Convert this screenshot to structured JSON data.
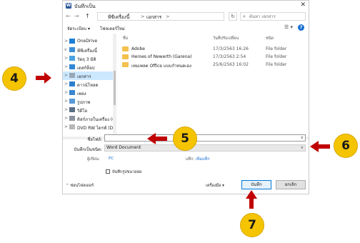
{
  "window": {
    "title": "บันทึกเป็น",
    "app_icon_letter": "W",
    "close_glyph": "✕"
  },
  "address": {
    "back_glyph": "←",
    "forward_glyph": "→",
    "up_glyph": "↑",
    "breadcrumbs": [
      "พีซีเครื่องนี้",
      "เอกสาร"
    ],
    "separator": ">",
    "refresh_glyph": "↻",
    "search_placeholder": "ค้นหา เอกสาร"
  },
  "toolbar": {
    "organize_label": "จัดระเบียบ ▾",
    "new_folder_label": "โฟลเดอร์ใหม่",
    "view_glyph": "☰ ▾",
    "help_glyph": "?"
  },
  "sidebar": {
    "items": [
      {
        "label": "OneDrive",
        "icon": "cloud-icon",
        "chevron": ">",
        "color": "#1a7fd4"
      },
      {
        "label": "พีซีเครื่องนี้",
        "icon": "computer-icon",
        "chevron": "v",
        "color": "#3b8fd8"
      },
      {
        "label": "วัตถุ 3 มิติ",
        "icon": "cube-icon",
        "chevron": ">",
        "color": "#4aa3e0"
      },
      {
        "label": "เดสก์ท็อป",
        "icon": "desktop-icon",
        "chevron": ">",
        "color": "#2f87d6"
      },
      {
        "label": "เอกสาร",
        "icon": "document-icon",
        "chevron": ">",
        "color": "#9aa7b5",
        "selected": true
      },
      {
        "label": "ดาวน์โหลด",
        "icon": "download-icon",
        "chevron": ">",
        "color": "#2d7fd0"
      },
      {
        "label": "เพลง",
        "icon": "music-icon",
        "chevron": ">",
        "color": "#3a86cf"
      },
      {
        "label": "รูปภาพ",
        "icon": "picture-icon",
        "chevron": ">",
        "color": "#5a9ad8"
      },
      {
        "label": "วิดีโอ",
        "icon": "video-icon",
        "chevron": ">",
        "color": "#5a6f86"
      },
      {
        "label": "ดิสก์ภายในเครื่อง (C",
        "icon": "drive-icon",
        "chevron": ">",
        "color": "#8a949e"
      },
      {
        "label": "DVD RW ไดรฟ์ (D",
        "icon": "dvd-icon",
        "chevron": ">",
        "color": "#b7b7b7"
      }
    ]
  },
  "files": {
    "columns": [
      "ชื่อ",
      "วันที่ปรับเปลี่ยน",
      "ชนิด"
    ],
    "rows": [
      {
        "name": "Adobe",
        "date": "17/3/2563 16:26",
        "type": "File folder"
      },
      {
        "name": "Heroes of Newerth (Garena)",
        "date": "17/3/2563 2:54",
        "type": "File folder"
      },
      {
        "name": "เทมเพลต Office แบบกำหนดเอง",
        "date": "25/6/2563 16:02",
        "type": "File folder"
      }
    ]
  },
  "form": {
    "filename_label": "ชื่อไฟล์:",
    "filename_value": "",
    "savetype_label": "บันทึกเป็นชนิด:",
    "savetype_value": "Word Document",
    "dropdown_glyph": "∨",
    "authors_label": "ผู้เขียน:",
    "authors_value": "PC",
    "tags_label": "แท็ก:",
    "tags_value": "เพิ่มแท็ก",
    "thumbnail_label": "บันทึกรูปขนาดย่อ"
  },
  "footer": {
    "hide_folders_label": "⌃ ซ่อนโฟลเดอร์",
    "tools_label": "เครื่องมือ   ▾",
    "save_label": "บันทึก",
    "cancel_label": "ยกเลิก"
  },
  "annotations": {
    "callout_color": "#f5c400",
    "arrow_color": "#c00000",
    "callouts": [
      "4",
      "5",
      "6",
      "7"
    ]
  }
}
